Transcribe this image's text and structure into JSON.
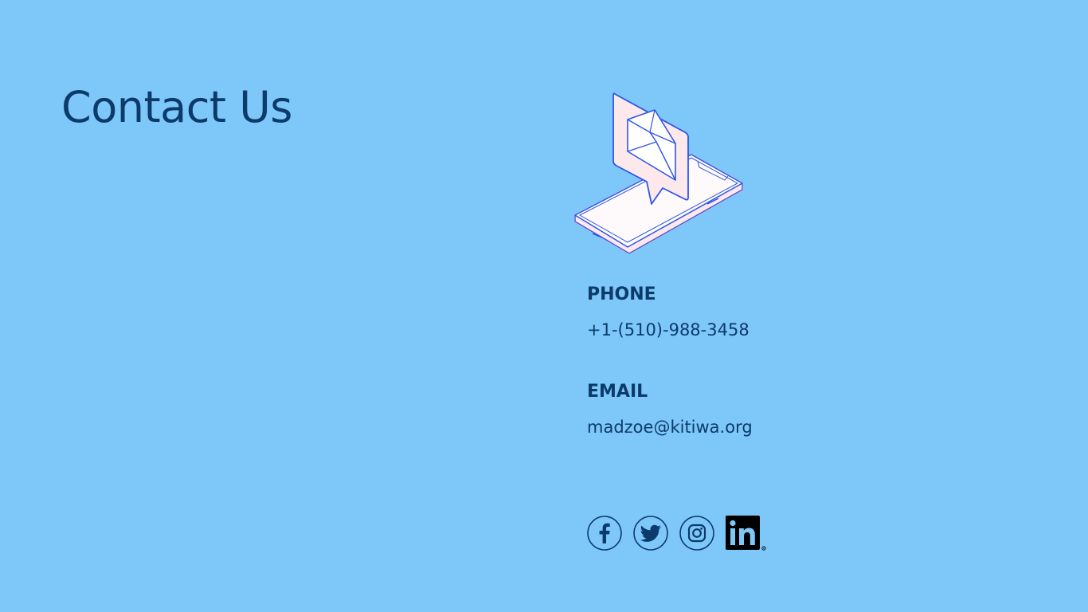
{
  "page": {
    "title": "Contact Us",
    "background_color": "#7dc8f9",
    "text_color": "#0c3a6b"
  },
  "contact": {
    "phone_label": "PHONE",
    "phone_value": "+1-(510)-988-3458",
    "email_label": "EMAIL",
    "email_value": "madzoe@kitiwa.org"
  },
  "illustration": {
    "icon": "phone-with-envelope-message-icon"
  },
  "socials": [
    {
      "icon": "facebook-icon"
    },
    {
      "icon": "twitter-icon"
    },
    {
      "icon": "instagram-icon"
    },
    {
      "icon": "linkedin-icon"
    }
  ]
}
